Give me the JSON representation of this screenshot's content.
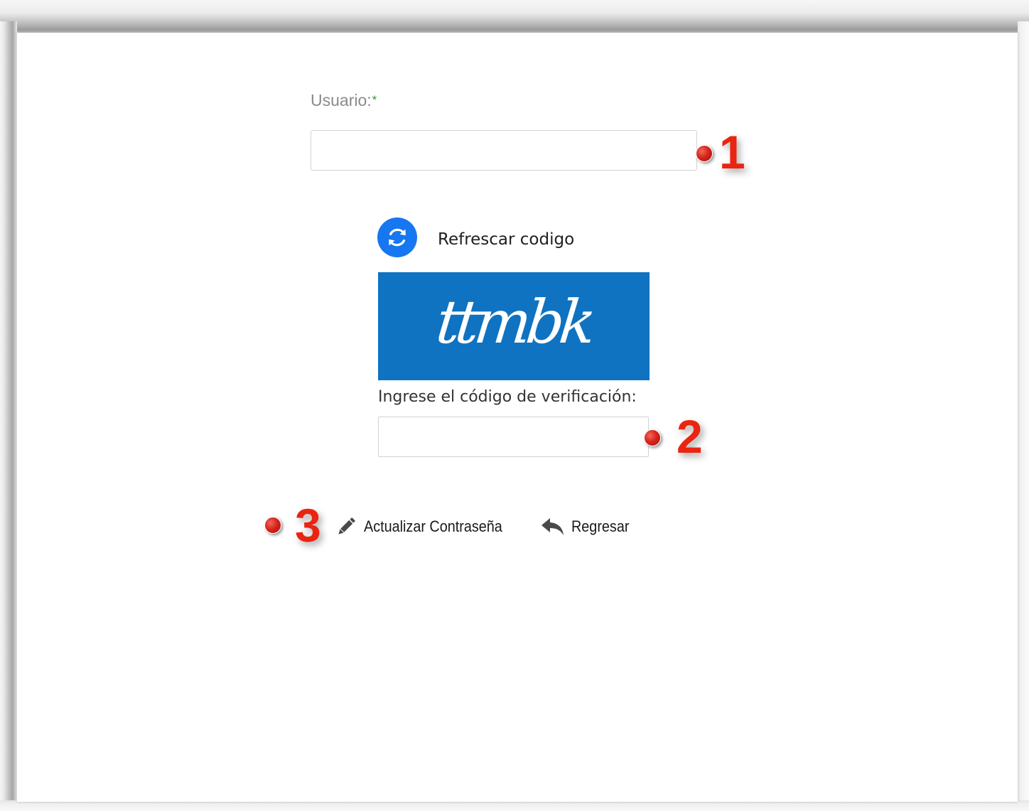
{
  "form": {
    "usuario_label": "Usuario:",
    "required_mark": "*",
    "usuario_value": "",
    "refresh_label": "Refrescar codigo",
    "captcha_text": "ttmbk",
    "verification_label": "Ingrese el código de verificación:",
    "verification_value": ""
  },
  "actions": {
    "update_password_label": "Actualizar Contraseña",
    "back_label": "Regresar"
  },
  "annotations": {
    "marker_1": "1",
    "marker_2": "2",
    "marker_3": "3"
  },
  "icons": {
    "refresh": "refresh-icon",
    "update": "pencil-icon",
    "back": "reply-icon"
  },
  "colors": {
    "captcha_background": "#0f73c1",
    "refresh_button": "#1777f0",
    "required_mark": "#2aa12a",
    "annotation_red": "#ea2410"
  }
}
